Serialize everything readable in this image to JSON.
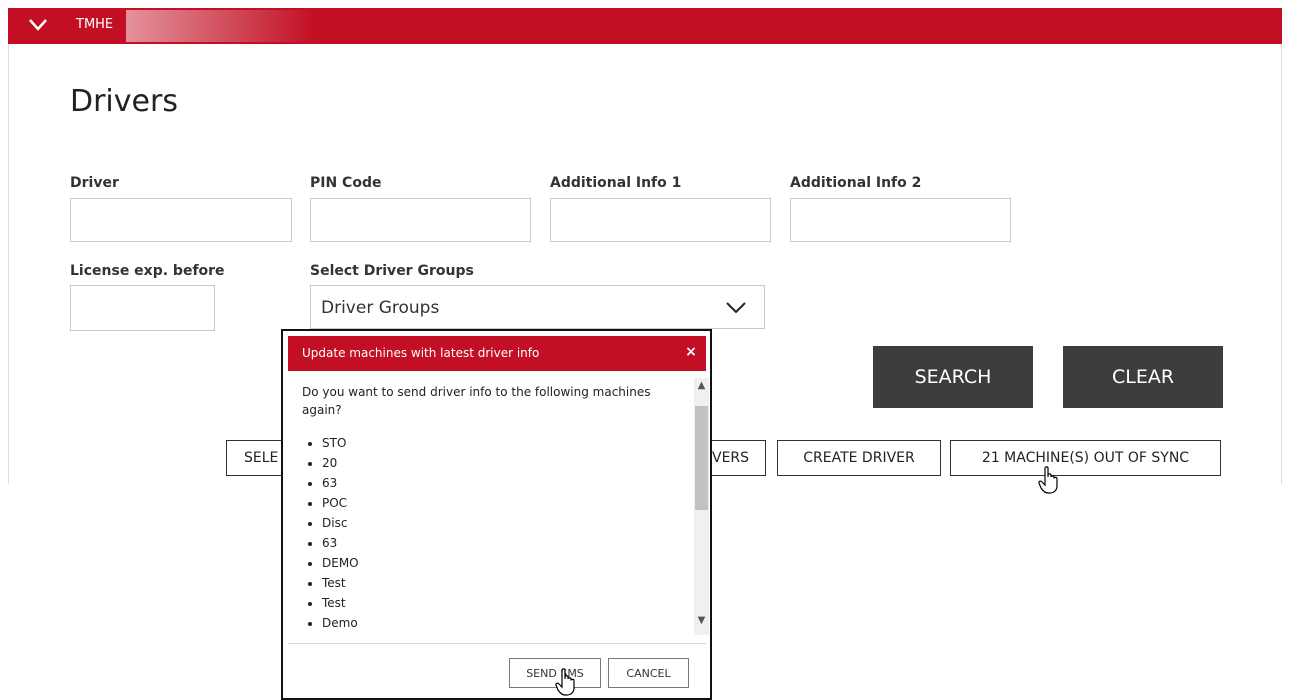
{
  "header": {
    "title": "TMHE",
    "expand_icon": "chevron-down-icon",
    "accent_color": "#c20f23"
  },
  "page": {
    "title": "Drivers"
  },
  "filters": {
    "driver_label": "Driver",
    "driver_value": "",
    "pin_label": "PIN Code",
    "pin_value": "",
    "info1_label": "Additional Info 1",
    "info1_value": "",
    "info2_label": "Additional Info 2",
    "info2_value": "",
    "license_label": "License exp. before",
    "license_value": "",
    "groups_label": "Select Driver Groups",
    "groups_value": "Driver Groups"
  },
  "actions": {
    "search": "SEARCH",
    "clear": "CLEAR"
  },
  "toolbar": {
    "select_label": "SELE",
    "drivers_label": "VERS",
    "create_driver": "CREATE DRIVER",
    "out_of_sync": "21 MACHINE(S) OUT OF SYNC"
  },
  "modal": {
    "title": "Update machines with latest driver info",
    "close": "×",
    "question": "Do you want to send driver info to the following machines again?",
    "machines": [
      "STO",
      "20",
      "63",
      "POC",
      "Disc",
      "63",
      "DEMO",
      "Test",
      "Test",
      "Demo"
    ],
    "send_sms": "SEND SMS",
    "cancel": "CANCEL"
  }
}
